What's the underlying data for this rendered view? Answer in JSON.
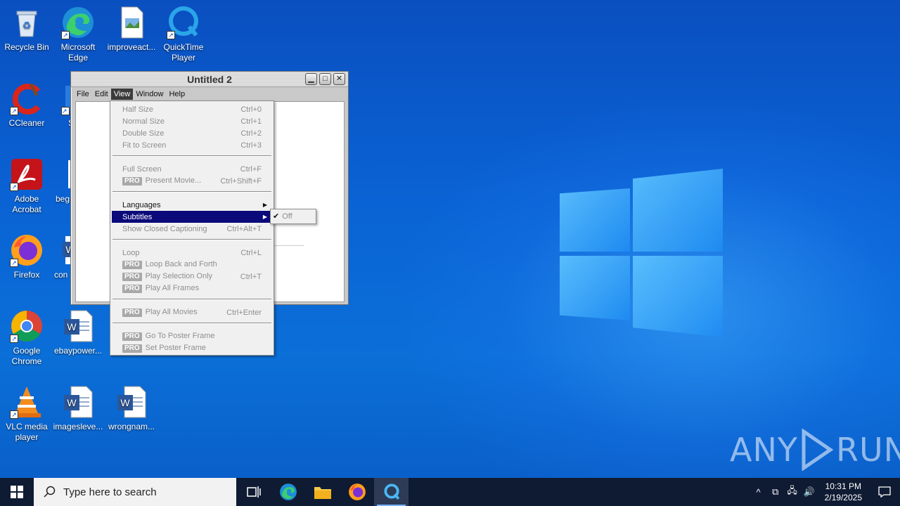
{
  "desktop": {
    "icons": [
      {
        "label": "Recycle Bin"
      },
      {
        "label": "Microsoft Edge"
      },
      {
        "label": "improveact..."
      },
      {
        "label": "QuickTime Player"
      },
      {
        "label": "CCleaner"
      },
      {
        "label": "Adobe Acrobat"
      },
      {
        "label": "Firefox"
      },
      {
        "label": "Google Chrome"
      },
      {
        "label": "ebaypower..."
      },
      {
        "label": "VLC media player"
      },
      {
        "label": "imagesleve..."
      },
      {
        "label": "wrongnam..."
      },
      {
        "label": "beg"
      },
      {
        "label": "con"
      },
      {
        "label": "S"
      }
    ],
    "watermark": {
      "left": "ANY",
      "right": "RUN"
    }
  },
  "window": {
    "title": "Untitled 2",
    "menubar": [
      "File",
      "Edit",
      "View",
      "Window",
      "Help"
    ]
  },
  "view_menu": {
    "items": [
      {
        "label": "Half Size",
        "shortcut": "Ctrl+0"
      },
      {
        "label": "Normal Size",
        "shortcut": "Ctrl+1"
      },
      {
        "label": "Double Size",
        "shortcut": "Ctrl+2"
      },
      {
        "label": "Fit to Screen",
        "shortcut": "Ctrl+3"
      },
      {
        "label": "Full Screen",
        "shortcut": "Ctrl+F"
      },
      {
        "label": "Present Movie...",
        "shortcut": "Ctrl+Shift+F",
        "pro": "PRO"
      },
      {
        "label": "Languages",
        "shortcut": ""
      },
      {
        "label": "Subtitles",
        "shortcut": ""
      },
      {
        "label": "Show Closed Captioning",
        "shortcut": "Ctrl+Alt+T"
      },
      {
        "label": "Loop",
        "shortcut": "Ctrl+L"
      },
      {
        "label": "Loop Back and Forth",
        "shortcut": "",
        "pro": "PRO"
      },
      {
        "label": "Play Selection Only",
        "shortcut": "Ctrl+T",
        "pro": "PRO"
      },
      {
        "label": "Play All Frames",
        "shortcut": "",
        "pro": "PRO"
      },
      {
        "label": "Play All Movies",
        "shortcut": "Ctrl+Enter",
        "pro": "PRO"
      },
      {
        "label": "Go To Poster Frame",
        "shortcut": "",
        "pro": "PRO"
      },
      {
        "label": "Set Poster Frame",
        "shortcut": "",
        "pro": "PRO"
      }
    ]
  },
  "subtitles_submenu": {
    "item": "Off",
    "checked": true
  },
  "taskbar": {
    "search_placeholder": "Type here to search",
    "time": "10:31 PM",
    "date": "2/19/2025"
  }
}
